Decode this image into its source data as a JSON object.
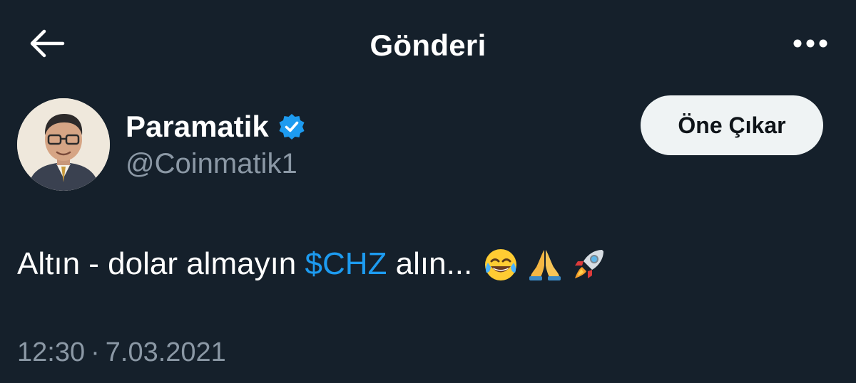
{
  "header": {
    "title": "Gönderi",
    "back_icon": "arrow-left-icon",
    "more_icon": "more-horizontal-icon"
  },
  "author": {
    "display_name": "Paramatik",
    "handle": "@Coinmatik1",
    "verified": true,
    "avatar_icon": "profile-avatar"
  },
  "actions": {
    "highlight_label": "Öne Çıkar"
  },
  "tweet": {
    "text_before": "Altın - dolar almayın ",
    "cashtag": "$CHZ",
    "text_after": " alın...",
    "emojis": [
      "tears-of-joy-emoji",
      "folded-hands-emoji",
      "rocket-emoji"
    ]
  },
  "meta": {
    "time": "12:30",
    "separator": "·",
    "date": "7.03.2021"
  },
  "colors": {
    "background": "#15202b",
    "accent": "#1d9bf0",
    "secondary_text": "#8b98a5",
    "button_bg": "#eff3f4"
  }
}
